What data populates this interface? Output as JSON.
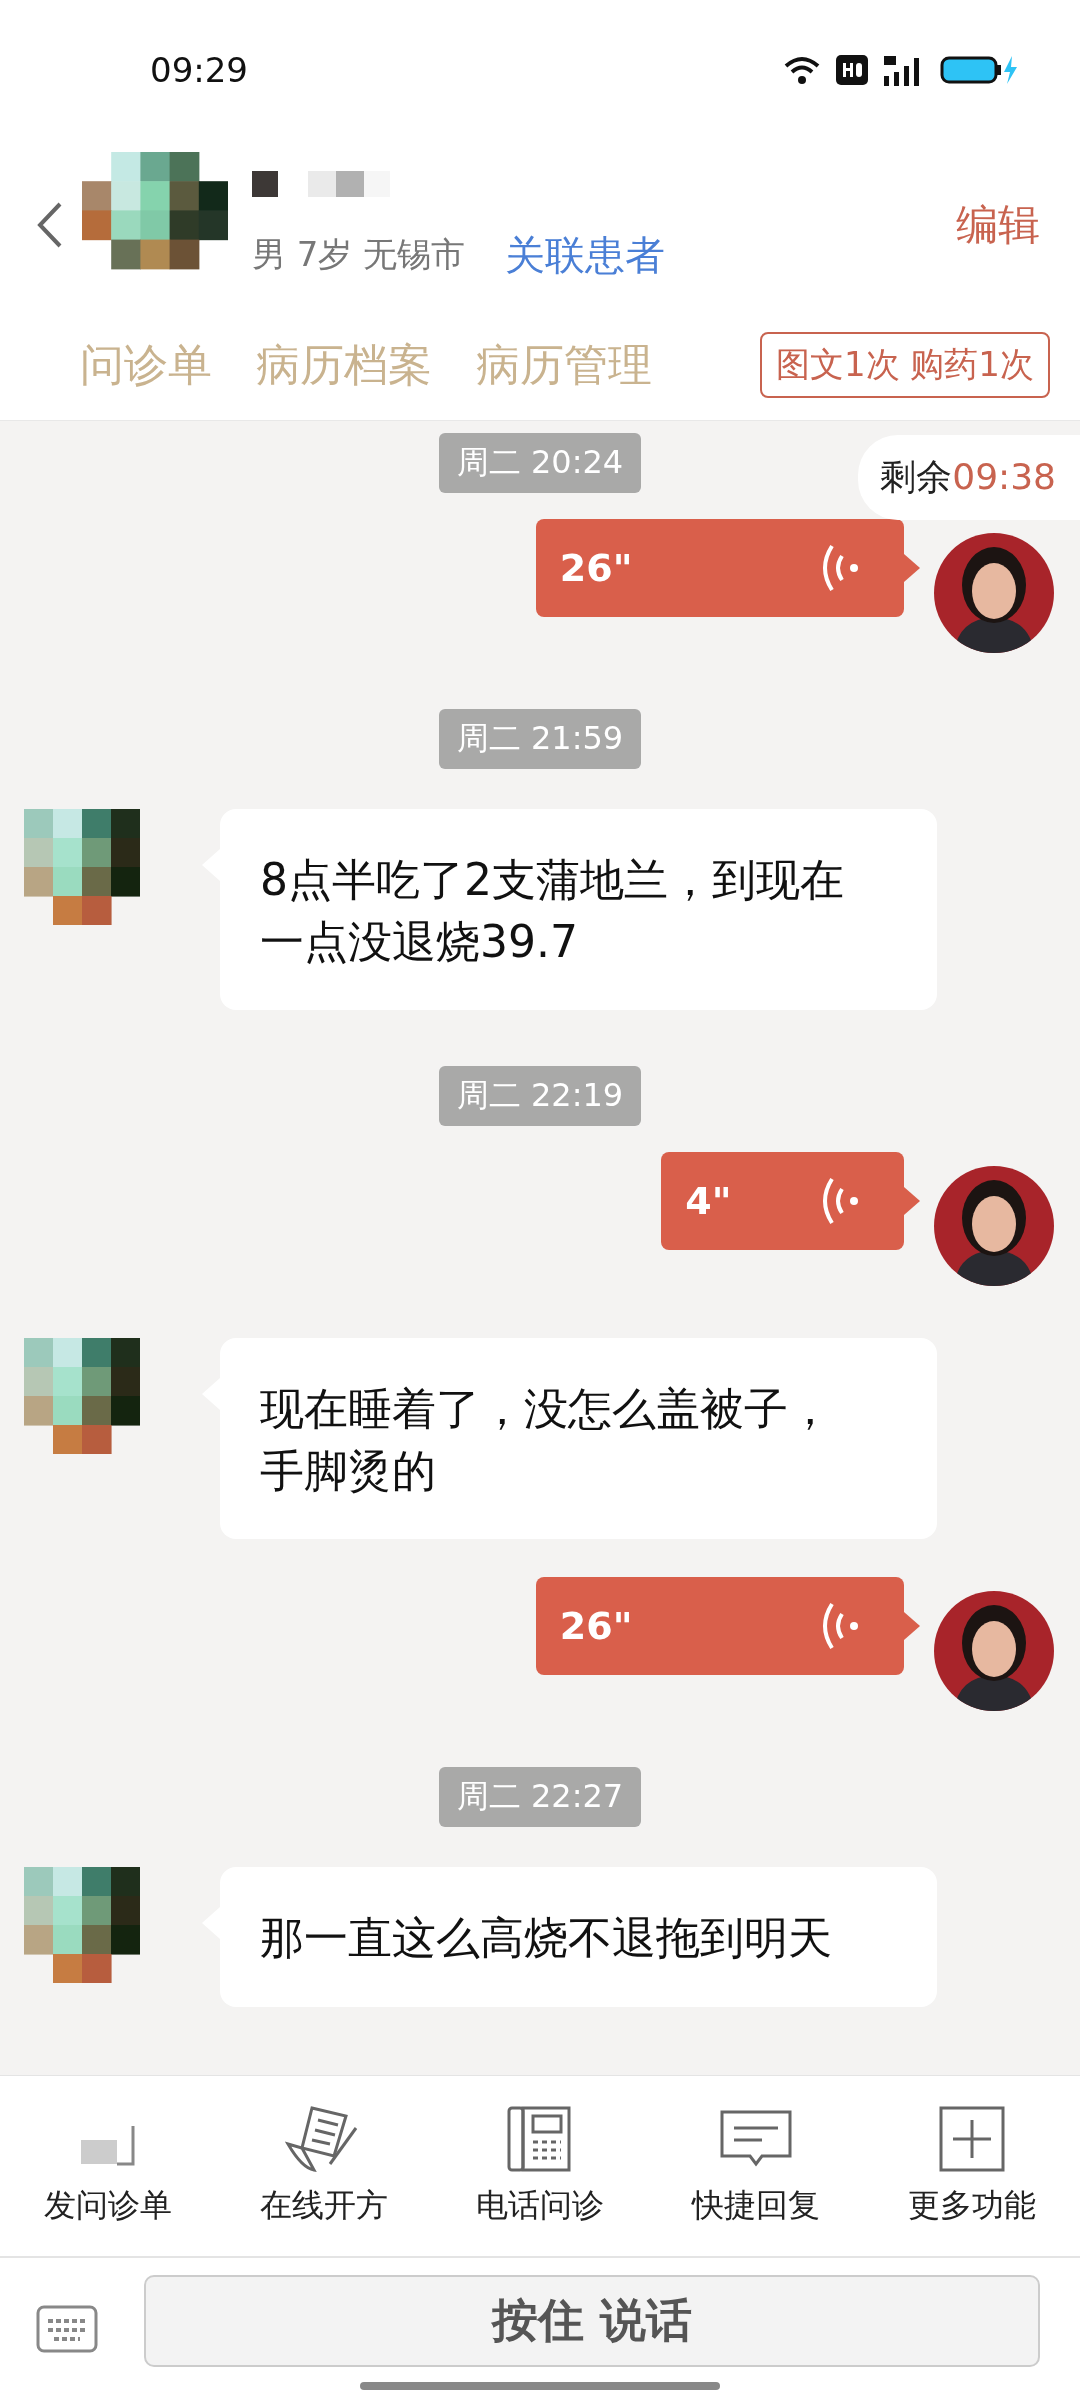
{
  "status_bar": {
    "time": "09:29"
  },
  "header": {
    "info": "男 7岁  无锡市",
    "link": "关联患者",
    "edit": "编辑"
  },
  "tabs": [
    {
      "label": "问诊单"
    },
    {
      "label": "病历档案"
    },
    {
      "label": "病历管理"
    }
  ],
  "quota": "图文1次 购药1次",
  "countdown": {
    "label": "剩余",
    "value": "09:38"
  },
  "messages": [
    {
      "kind": "time",
      "text": "周二 20:24"
    },
    {
      "kind": "voice",
      "duration": "26\""
    },
    {
      "kind": "time",
      "text": "周二 21:59"
    },
    {
      "kind": "text",
      "text": "8点半吃了2支蒲地兰，到现在一点没退烧39.7"
    },
    {
      "kind": "time",
      "text": "周二 22:19"
    },
    {
      "kind": "voice",
      "duration": "4\""
    },
    {
      "kind": "text",
      "text": "现在睡着了，没怎么盖被子，手脚烫的"
    },
    {
      "kind": "voice",
      "duration": "26\""
    },
    {
      "kind": "time",
      "text": "周二 22:27"
    },
    {
      "kind": "text",
      "text": "那一直这么高烧不退拖到明天"
    }
  ],
  "tools": [
    {
      "kind": "form",
      "label": "发问诊单"
    },
    {
      "kind": "rx",
      "label": "在线开方"
    },
    {
      "kind": "phone",
      "label": "电话问诊"
    },
    {
      "kind": "reply",
      "label": "快捷回复"
    },
    {
      "kind": "more",
      "label": "更多功能"
    }
  ],
  "talk_button": "按住 说话"
}
